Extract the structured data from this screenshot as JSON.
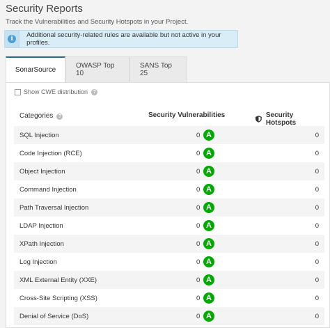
{
  "header": {
    "title": "Security Reports",
    "description": "Track the Vulnerabilities and Security Hotspots in your Project."
  },
  "banner": {
    "icon": "info-icon",
    "text": "Additional security-related rules are available but not active in your profiles."
  },
  "tabs": [
    {
      "label": "SonarSource",
      "active": true
    },
    {
      "label": "OWASP Top 10",
      "active": false
    },
    {
      "label": "SANS Top 25",
      "active": false
    }
  ],
  "options": {
    "show_cwe_label": "Show CWE distribution",
    "show_cwe_checked": false
  },
  "table": {
    "headers": {
      "categories": "Categories",
      "vulnerabilities": "Security Vulnerabilities",
      "hotspots": "Security Hotspots"
    },
    "rows": [
      {
        "category": "SQL Injection",
        "vulns": "0",
        "rating": "A",
        "hotspots": "0"
      },
      {
        "category": "Code Injection (RCE)",
        "vulns": "0",
        "rating": "A",
        "hotspots": "0"
      },
      {
        "category": "Object Injection",
        "vulns": "0",
        "rating": "A",
        "hotspots": "0"
      },
      {
        "category": "Command Injection",
        "vulns": "0",
        "rating": "A",
        "hotspots": "0"
      },
      {
        "category": "Path Traversal Injection",
        "vulns": "0",
        "rating": "A",
        "hotspots": "0"
      },
      {
        "category": "LDAP Injection",
        "vulns": "0",
        "rating": "A",
        "hotspots": "0"
      },
      {
        "category": "XPath Injection",
        "vulns": "0",
        "rating": "A",
        "hotspots": "0"
      },
      {
        "category": "Log Injection",
        "vulns": "0",
        "rating": "A",
        "hotspots": "0"
      },
      {
        "category": "XML External Entity (XXE)",
        "vulns": "0",
        "rating": "A",
        "hotspots": "0"
      },
      {
        "category": "Cross-Site Scripting (XSS)",
        "vulns": "0",
        "rating": "A",
        "hotspots": "0"
      },
      {
        "category": "Denial of Service (DoS)",
        "vulns": "0",
        "rating": "A",
        "hotspots": "0"
      }
    ]
  },
  "colors": {
    "rating_a": "#00aa00",
    "active_tab_accent": "#236a97",
    "banner_bg": "#d9edf7"
  }
}
